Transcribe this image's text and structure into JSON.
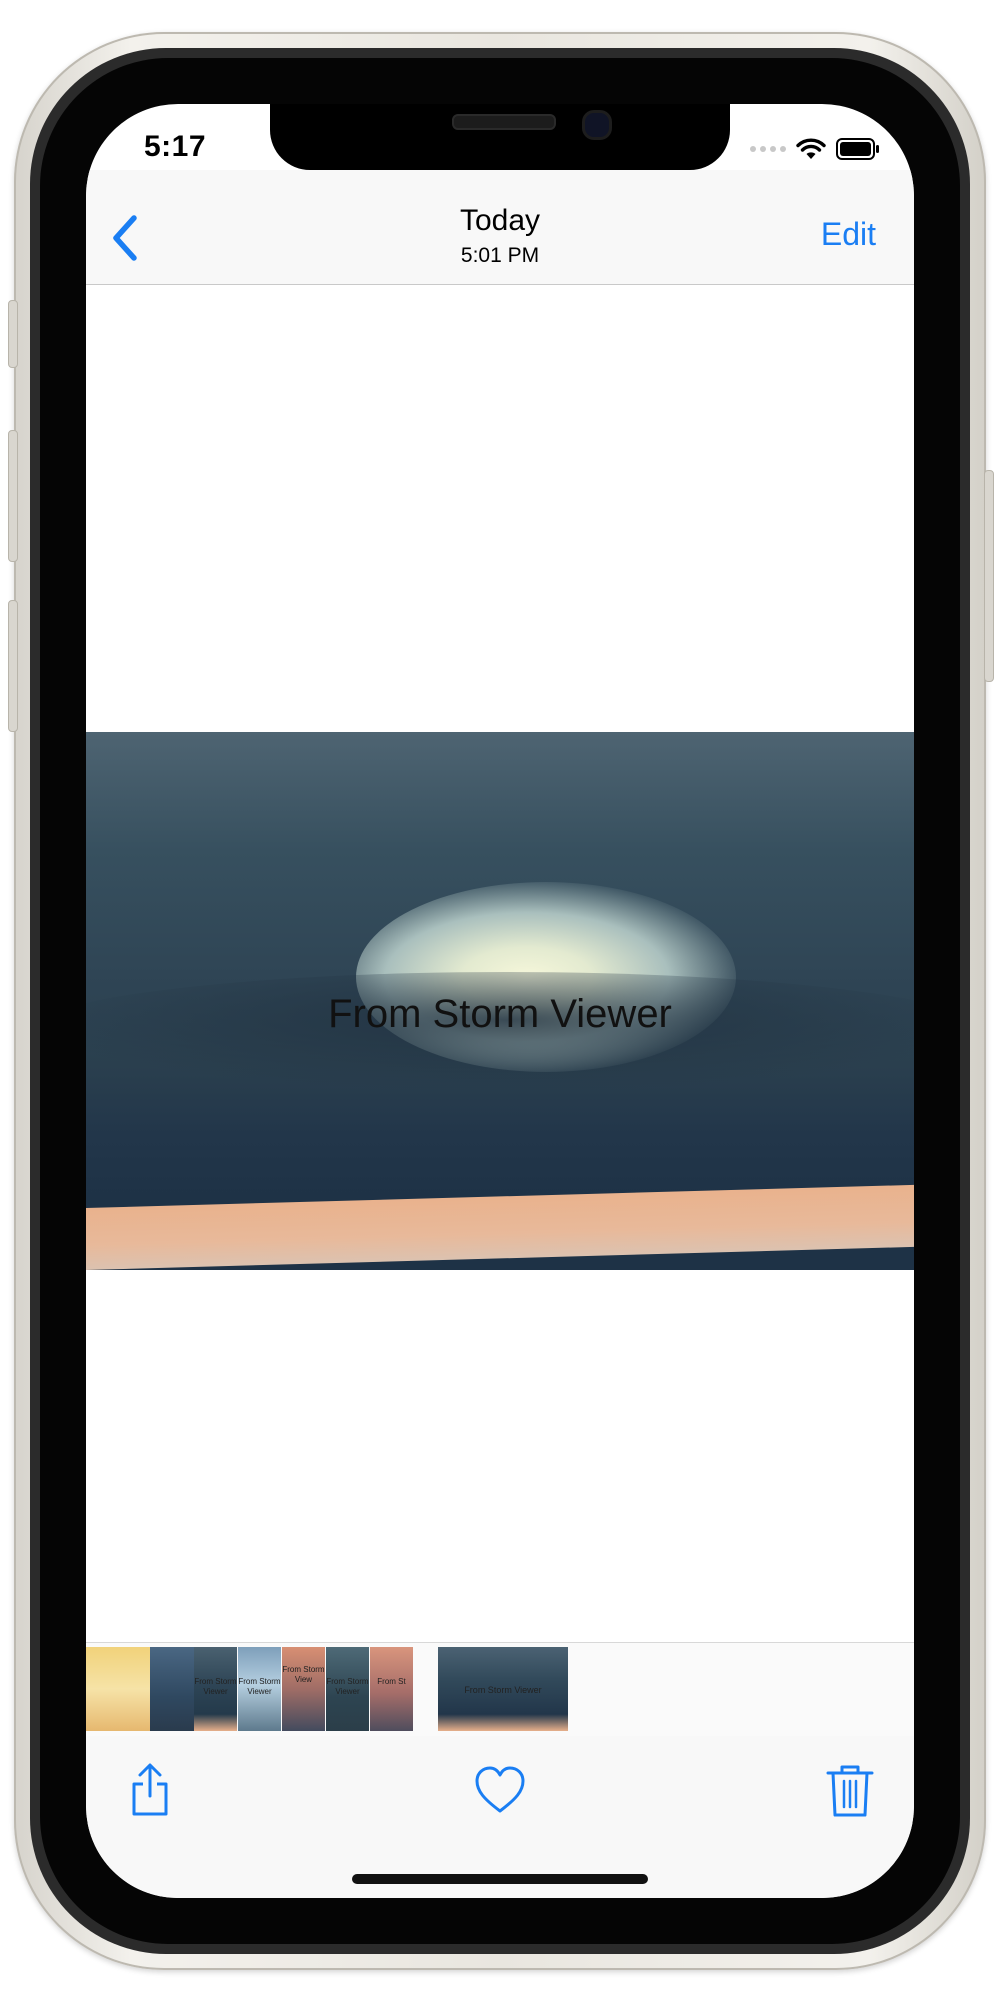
{
  "status_bar": {
    "time": "5:17"
  },
  "nav": {
    "title": "Today",
    "subtitle": "5:01 PM",
    "edit_label": "Edit"
  },
  "photo": {
    "caption": "From Storm Viewer"
  },
  "thumbnails": [
    {
      "caption": ""
    },
    {
      "caption": ""
    },
    {
      "caption": "From Storm Viewer"
    },
    {
      "caption": "From Storm Viewer"
    },
    {
      "caption": "From Storm View"
    },
    {
      "caption": "From Storm Viewer"
    },
    {
      "caption": "From St"
    },
    {
      "caption": "From Storm Viewer"
    }
  ],
  "toolbar": {
    "share_icon": "share-icon",
    "favorite_icon": "heart-icon",
    "delete_icon": "trash-icon"
  },
  "colors": {
    "accent": "#1a7ef3",
    "bar_background": "#f8f8f8"
  }
}
